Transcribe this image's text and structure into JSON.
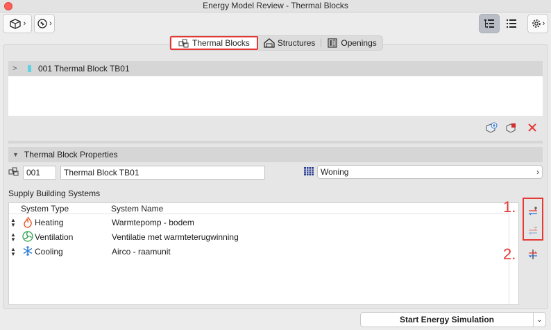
{
  "window": {
    "title": "Energy Model Review - Thermal Blocks"
  },
  "toolbar": {
    "model_button_icon": "building-cube-icon",
    "refresh_button_icon": "refresh-arrows-icon",
    "tree_view_icon": "tree-view-icon",
    "list_view_icon": "list-view-icon",
    "settings_icon": "gear-icon"
  },
  "tabs": [
    {
      "label": "Thermal Blocks",
      "icon": "thermal-blocks-icon",
      "selected": true
    },
    {
      "label": "Structures",
      "icon": "house-icon",
      "selected": false
    },
    {
      "label": "Openings",
      "icon": "door-icon",
      "selected": false
    }
  ],
  "tree": {
    "items": [
      {
        "label": "001 Thermal Block TB01",
        "color": "#5fd3e0"
      }
    ]
  },
  "tree_actions": {
    "add_icon": "add-block-icon",
    "assign_icon": "assign-block-icon",
    "delete_icon": "delete-x-icon"
  },
  "properties": {
    "header": "Thermal Block Properties",
    "id_value": "001",
    "name_value": "Thermal Block TB01",
    "function_value": "Woning"
  },
  "supply": {
    "label": "Supply Building Systems",
    "columns": {
      "type": "System Type",
      "name": "System Name"
    },
    "rows": [
      {
        "type": "Heating",
        "name": "Warmtepomp - bodem",
        "icon": "flame-icon"
      },
      {
        "type": "Ventilation",
        "name": "Ventilatie met warmteterugwinning",
        "icon": "fan-icon"
      },
      {
        "type": "Cooling",
        "name": "Airco - raamunit",
        "icon": "snowflake-icon"
      }
    ]
  },
  "callouts": {
    "one": "1.",
    "two": "2."
  },
  "footer": {
    "start_label": "Start Energy Simulation"
  }
}
